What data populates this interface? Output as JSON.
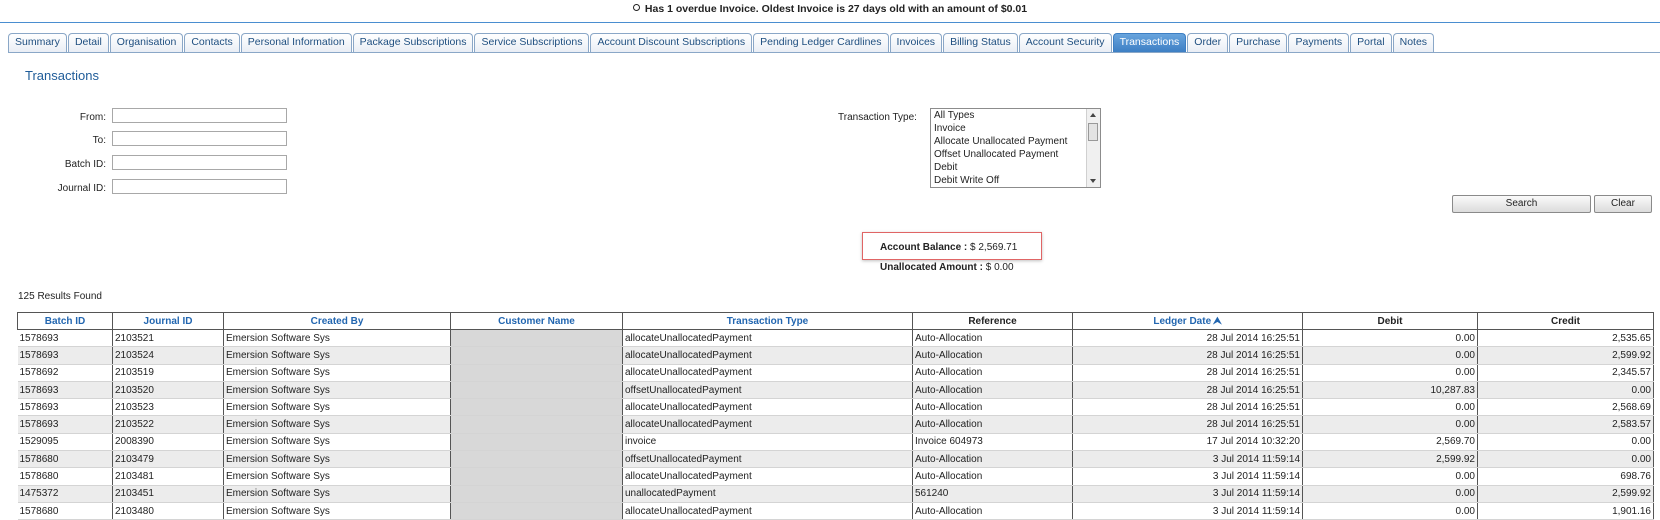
{
  "alert": {
    "text": "Has 1 overdue Invoice. Oldest Invoice is 27 days old with an amount of $0.01"
  },
  "tabs": [
    {
      "label": "Summary"
    },
    {
      "label": "Detail"
    },
    {
      "label": "Organisation"
    },
    {
      "label": "Contacts"
    },
    {
      "label": "Personal Information"
    },
    {
      "label": "Package Subscriptions"
    },
    {
      "label": "Service Subscriptions"
    },
    {
      "label": "Account Discount Subscriptions"
    },
    {
      "label": "Pending Ledger Cardlines"
    },
    {
      "label": "Invoices"
    },
    {
      "label": "Billing Status"
    },
    {
      "label": "Account Security"
    },
    {
      "label": "Transactions",
      "active": true
    },
    {
      "label": "Order"
    },
    {
      "label": "Purchase"
    },
    {
      "label": "Payments"
    },
    {
      "label": "Portal"
    },
    {
      "label": "Notes"
    }
  ],
  "panel": {
    "title": "Transactions"
  },
  "filters": {
    "from_label": "From:",
    "from_value": "",
    "to_label": "To:",
    "to_value": "",
    "batch_label": "Batch ID:",
    "batch_value": "",
    "journal_label": "Journal ID:",
    "journal_value": "",
    "type_label": "Transaction Type:",
    "type_options": [
      "All Types",
      "Invoice",
      "Allocate Unallocated Payment",
      "Offset Unallocated Payment",
      "Debit",
      "Debit Write Off"
    ]
  },
  "buttons": {
    "search": "Search",
    "clear": "Clear"
  },
  "summary": {
    "balance_label": "Account Balance :",
    "balance_value": "$ 2,569.71",
    "unallocated_label": "Unallocated Amount :",
    "unallocated_value": "$ 0.00"
  },
  "results_text": "125 Results Found",
  "table": {
    "headers": [
      "Batch ID",
      "Journal ID",
      "Created By",
      "Customer Name",
      "Transaction Type",
      "Reference",
      "Ledger Date",
      "Debit",
      "Credit"
    ],
    "rows": [
      [
        "1578693",
        "2103521",
        "Emersion Software Sys",
        "",
        "allocateUnallocatedPayment",
        "Auto-Allocation",
        "28 Jul 2014 16:25:51",
        "0.00",
        "2,535.65"
      ],
      [
        "1578693",
        "2103524",
        "Emersion Software Sys",
        "",
        "allocateUnallocatedPayment",
        "Auto-Allocation",
        "28 Jul 2014 16:25:51",
        "0.00",
        "2,599.92"
      ],
      [
        "1578692",
        "2103519",
        "Emersion Software Sys",
        "",
        "allocateUnallocatedPayment",
        "Auto-Allocation",
        "28 Jul 2014 16:25:51",
        "0.00",
        "2,345.57"
      ],
      [
        "1578693",
        "2103520",
        "Emersion Software Sys",
        "",
        "offsetUnallocatedPayment",
        "Auto-Allocation",
        "28 Jul 2014 16:25:51",
        "10,287.83",
        "0.00"
      ],
      [
        "1578693",
        "2103523",
        "Emersion Software Sys",
        "",
        "allocateUnallocatedPayment",
        "Auto-Allocation",
        "28 Jul 2014 16:25:51",
        "0.00",
        "2,568.69"
      ],
      [
        "1578693",
        "2103522",
        "Emersion Software Sys",
        "",
        "allocateUnallocatedPayment",
        "Auto-Allocation",
        "28 Jul 2014 16:25:51",
        "0.00",
        "2,583.57"
      ],
      [
        "1529095",
        "2008390",
        "Emersion Software Sys",
        "",
        "invoice",
        "Invoice 604973",
        "17 Jul 2014 10:32:20",
        "2,569.70",
        "0.00"
      ],
      [
        "1578680",
        "2103479",
        "Emersion Software Sys",
        "",
        "offsetUnallocatedPayment",
        "Auto-Allocation",
        "3 Jul 2014 11:59:14",
        "2,599.92",
        "0.00"
      ],
      [
        "1578680",
        "2103481",
        "Emersion Software Sys",
        "",
        "allocateUnallocatedPayment",
        "Auto-Allocation",
        "3 Jul 2014 11:59:14",
        "0.00",
        "698.76"
      ],
      [
        "1475372",
        "2103451",
        "Emersion Software Sys",
        "",
        "unallocatedPayment",
        "561240",
        "3 Jul 2014 11:59:14",
        "0.00",
        "2,599.92"
      ],
      [
        "1578680",
        "2103480",
        "Emersion Software Sys",
        "",
        "allocateUnallocatedPayment",
        "Auto-Allocation",
        "3 Jul 2014 11:59:14",
        "0.00",
        "1,901.16"
      ]
    ]
  }
}
